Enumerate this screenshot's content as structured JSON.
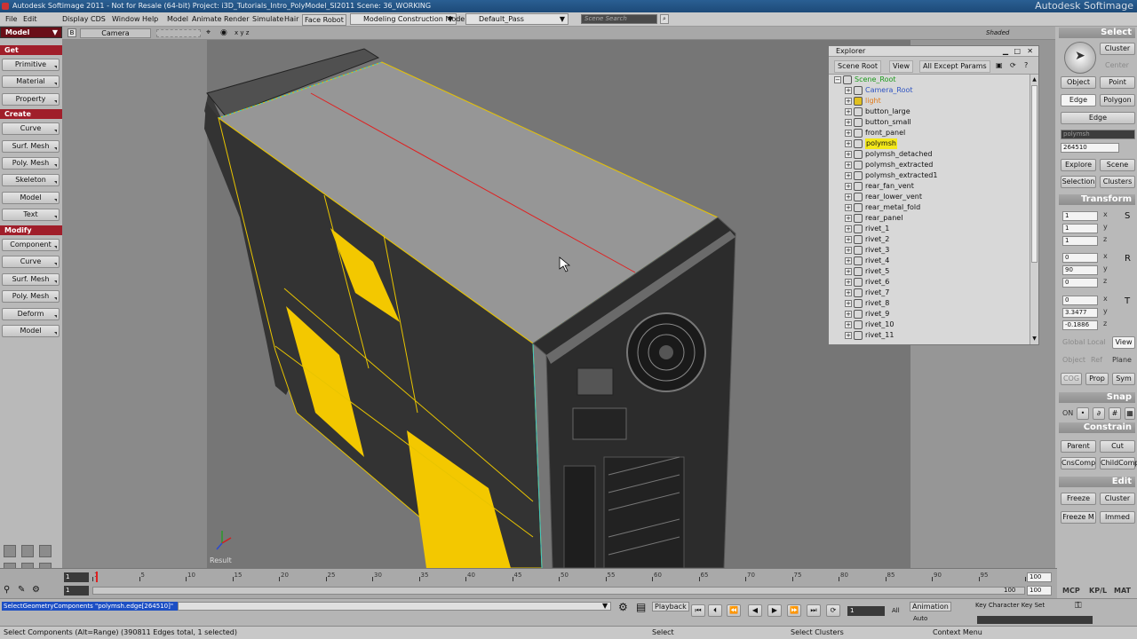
{
  "window": {
    "title": "Autodesk Softimage 2011 - Not for Resale (64-bit)   Project: i3D_Tutorials_Intro_PolyModel_SI2011   Scene: 36_WORKING",
    "brand": "Autodesk Softimage"
  },
  "menu": {
    "items": [
      "File",
      "Edit",
      "Display",
      "CDS",
      "Window",
      "Help",
      "Model",
      "Animate",
      "Render",
      "Simulate",
      "Hair",
      "Face Robot"
    ],
    "mode_dropdown": "Modeling Construction Mode",
    "pass_dropdown": "Default_Pass",
    "search_placeholder": "Scene Search"
  },
  "left_panel": {
    "toolbar_mode": "Model",
    "get_header": "Get",
    "get_items": [
      "Primitive",
      "Material",
      "Property"
    ],
    "create_header": "Create",
    "create_items": [
      "Curve",
      "Surf. Mesh",
      "Poly. Mesh",
      "Skeleton",
      "Model",
      "Text"
    ],
    "modify_header": "Modify",
    "modify_items": [
      "Component",
      "Curve",
      "Surf. Mesh",
      "Poly. Mesh",
      "Deform",
      "Model"
    ]
  },
  "viewport": {
    "camera": "Camera",
    "axes": "x y z",
    "display_mode": "Shaded",
    "corner_label": "Result"
  },
  "explorer": {
    "title": "Explorer",
    "scope_button": "Scene Root",
    "view_button": "View",
    "filter_button": "All Except Params",
    "nodes": [
      {
        "label": "Scene_Root",
        "color": "#1b9a1b"
      },
      {
        "label": "Camera_Root",
        "color": "#2f54c2"
      },
      {
        "label": "light",
        "color": "#e07a1a"
      },
      {
        "label": "button_large",
        "color": "#111111"
      },
      {
        "label": "button_small",
        "color": "#111111"
      },
      {
        "label": "front_panel",
        "color": "#111111"
      },
      {
        "label": "polymsh",
        "color": "#111111",
        "highlight": "#f3e81a"
      },
      {
        "label": "polymsh_detached",
        "color": "#111111"
      },
      {
        "label": "polymsh_extracted",
        "color": "#111111"
      },
      {
        "label": "polymsh_extracted1",
        "color": "#111111"
      },
      {
        "label": "rear_fan_vent",
        "color": "#111111"
      },
      {
        "label": "rear_lower_vent",
        "color": "#111111"
      },
      {
        "label": "rear_metal_fold",
        "color": "#111111"
      },
      {
        "label": "rear_panel",
        "color": "#111111"
      },
      {
        "label": "rivet_1",
        "color": "#111111"
      },
      {
        "label": "rivet_2",
        "color": "#111111"
      },
      {
        "label": "rivet_3",
        "color": "#111111"
      },
      {
        "label": "rivet_4",
        "color": "#111111"
      },
      {
        "label": "rivet_5",
        "color": "#111111"
      },
      {
        "label": "rivet_6",
        "color": "#111111"
      },
      {
        "label": "rivet_7",
        "color": "#111111"
      },
      {
        "label": "rivet_8",
        "color": "#111111"
      },
      {
        "label": "rivet_9",
        "color": "#111111"
      },
      {
        "label": "rivet_10",
        "color": "#111111"
      },
      {
        "label": "rivet_11",
        "color": "#111111"
      }
    ]
  },
  "right_panel": {
    "select_header": "Select",
    "cluster": "Cluster",
    "center": "Center",
    "object": "Object",
    "point": "Point",
    "edge": "Edge",
    "polygon": "Polygon",
    "edge_filter": "Edge",
    "object_name": "polymsh",
    "selection_value": "264510",
    "explore": "Explore",
    "scene": "Scene",
    "selection": "Selection",
    "clusters": "Clusters",
    "transform_header": "Transform",
    "scale": [
      "1",
      "1",
      "1"
    ],
    "rotation": [
      "0",
      "90",
      "0"
    ],
    "translation": [
      "0",
      "3.3477",
      "-0.1886"
    ],
    "axis_x": "x",
    "axis_y": "y",
    "axis_z": "z",
    "global": "Global",
    "local": "Local",
    "view": "View",
    "object_ref": "Object",
    "ref": "Ref",
    "plane": "Plane",
    "cog": "COG",
    "prop": "Prop",
    "sym": "Sym",
    "snap_header": "Snap",
    "snap_on": "ON",
    "constrain_header": "Constrain",
    "parent": "Parent",
    "cut": "Cut",
    "cnscomp": "CnsComp",
    "childcomp": "ChildComp",
    "edit_header": "Edit",
    "freeze": "Freeze",
    "cluster2": "Cluster",
    "freeze_m": "Freeze M",
    "immed": "Immed",
    "tabs": [
      "MCP",
      "KP/L",
      "MAT"
    ]
  },
  "timeline": {
    "start": "1",
    "start2": "1",
    "end": "100",
    "end2": "100",
    "end3": "100",
    "ticks": [
      "1",
      "5",
      "10",
      "15",
      "20",
      "25",
      "30",
      "35",
      "40",
      "45",
      "50",
      "55",
      "60",
      "65",
      "70",
      "75",
      "80",
      "85",
      "90",
      "95",
      "100"
    ]
  },
  "command": {
    "text": "SelectGeometryComponents \"polymsh.edge[264510]\"",
    "playback": "Playback",
    "frame": "1",
    "all": "All",
    "animation": "Animation",
    "auto": "Auto",
    "keying": "Key Character Key Set"
  },
  "status": {
    "left": "Select Components (Alt=Range) (390811 Edges total, 1 selected)",
    "mid1": "Select",
    "mid2": "Select Clusters",
    "mid3": "Context Menu"
  },
  "colors": {
    "title_bar": "#2a5f93",
    "header_red": "#a01e2a",
    "selection_yellow": "#f3c800",
    "wire_yellow": "#e8c400",
    "wire_cyan": "#3cc6c6",
    "wire_red": "#e02020"
  }
}
